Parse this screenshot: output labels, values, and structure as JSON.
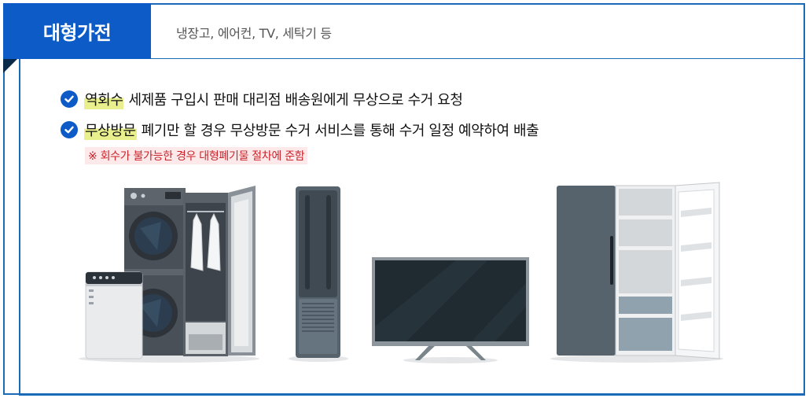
{
  "header": {
    "category": "대형가전",
    "examples": "냉장고, 에어컨, TV, 세탁기 등"
  },
  "items": [
    {
      "tag": "역회수",
      "text": "세제품 구입시 판매 대리점 배송원에게 무상으로 수거 요청"
    },
    {
      "tag": "무상방문",
      "text": "폐기만 할 경우 무상방문 수거 서비스를 통해 수거 일정 예약하여 배출"
    }
  ],
  "note": "※ 회수가 불가능한 경우 대형폐기물 절차에 준함",
  "colors": {
    "brand_blue": "#0c5bc6",
    "border_blue": "#1b6ab8",
    "highlight": "#e8ef8c",
    "note_red": "#c8242b"
  }
}
